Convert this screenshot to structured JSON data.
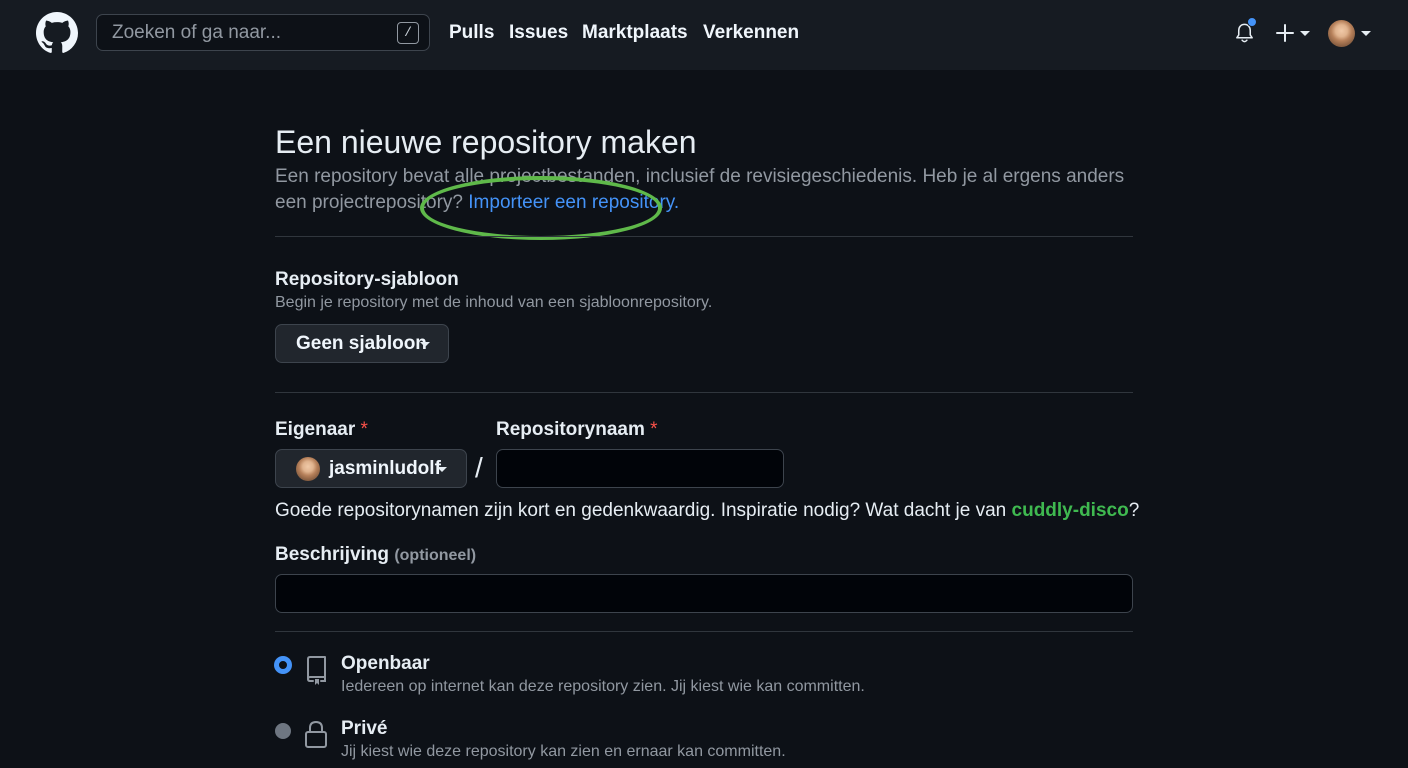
{
  "header": {
    "search_placeholder": "Zoeken of ga naar...",
    "search_shortcut": "/",
    "nav": [
      "Pulls",
      "Issues",
      "Marktplaats",
      "Verkennen"
    ]
  },
  "page": {
    "title": "Een nieuwe repository maken",
    "intro_text": "Een repository bevat alle projectbestanden, inclusief de revisiegeschiedenis. Heb je al ergens anders een projectrepository? ",
    "import_link": "Importeer een repository."
  },
  "template": {
    "label": "Repository-sjabloon",
    "hint": "Begin je repository met de inhoud van een sjabloonrepository.",
    "button": "Geen sjabloon"
  },
  "owner": {
    "label": "Eigenaar",
    "required_mark": "*",
    "value": "jasminludolf"
  },
  "repo_name": {
    "label": "Repositorynaam",
    "required_mark": "*",
    "value": "",
    "separator": "/"
  },
  "name_help": {
    "text": "Goede repositorynamen zijn kort en gedenkwaardig. Inspiratie nodig? Wat dacht je van ",
    "suggestion": "cuddly-disco",
    "suffix": "?"
  },
  "description": {
    "label": "Beschrijving",
    "optional": "(optioneel)",
    "value": ""
  },
  "visibility": {
    "public": {
      "title": "Openbaar",
      "desc": "Iedereen op internet kan deze repository zien. Jij kiest wie kan committen.",
      "selected": true
    },
    "private": {
      "title": "Privé",
      "desc": "Jij kiest wie deze repository kan zien en ernaar kan committen.",
      "selected": false
    }
  },
  "colors": {
    "link": "#4493f8",
    "suggestion": "#3fb950",
    "annotation": "#5fb94a",
    "required": "#f85149"
  }
}
